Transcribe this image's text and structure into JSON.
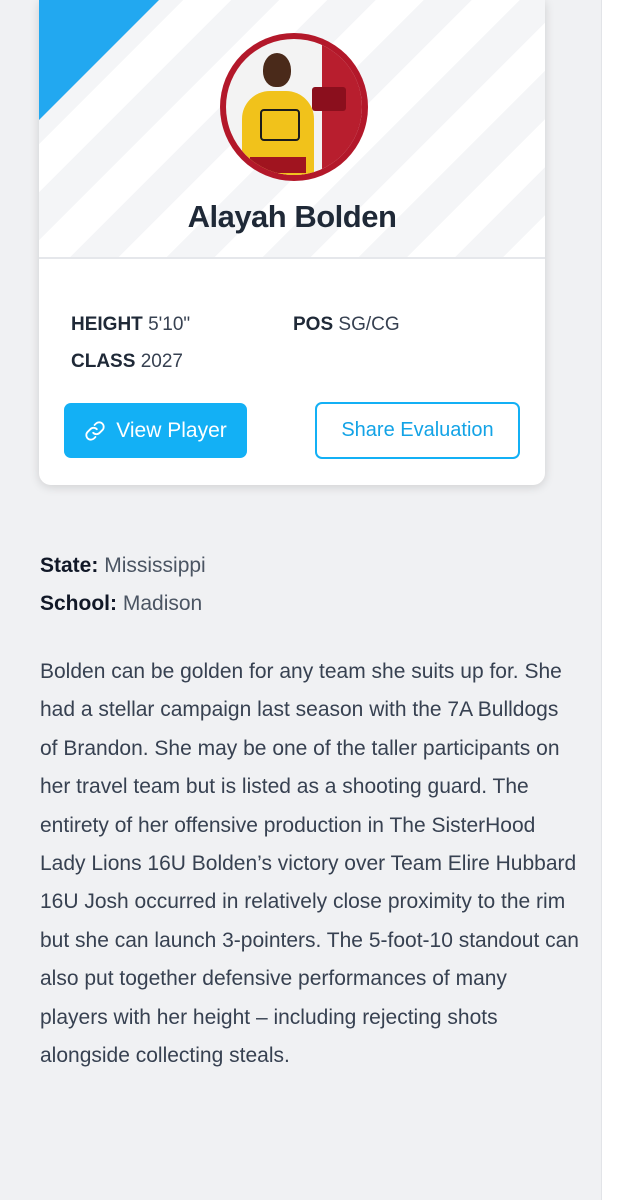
{
  "player": {
    "name": "Alayah Bolden",
    "photo_caption": "ALAYAH BOLDEN",
    "height_label": "HEIGHT",
    "height_value": "5'10\"",
    "pos_label": "POS",
    "pos_value": "SG/CG",
    "class_label": "CLASS",
    "class_value": "2027"
  },
  "actions": {
    "view_player_label": "View Player",
    "share_evaluation_label": "Share Evaluation"
  },
  "details": {
    "state_label": "State:",
    "state_value": "Mississippi",
    "school_label": "School:",
    "school_value": "Madison"
  },
  "evaluation": {
    "text": "Bolden can be golden for any team she suits up for. She had a stellar campaign last season with the 7A Bulldogs of Brandon. She may be one of the taller participants on her travel team but is listed as a shooting guard. The entirety of her offensive production in The SisterHood Lady Lions 16U Bolden’s victory over Team Elire Hubbard 16U Josh occurred in relatively close proximity to the rim but she can launch 3-pointers. The 5-foot-10 standout can also put together defensive performances of many players with her height – including rejecting shots alongside collecting steals."
  },
  "colors": {
    "accent": "#13b0f5",
    "ribbon": "#22a8f0",
    "avatar_ring": "#b3182a"
  },
  "icons": {
    "view_player": "link-icon"
  }
}
